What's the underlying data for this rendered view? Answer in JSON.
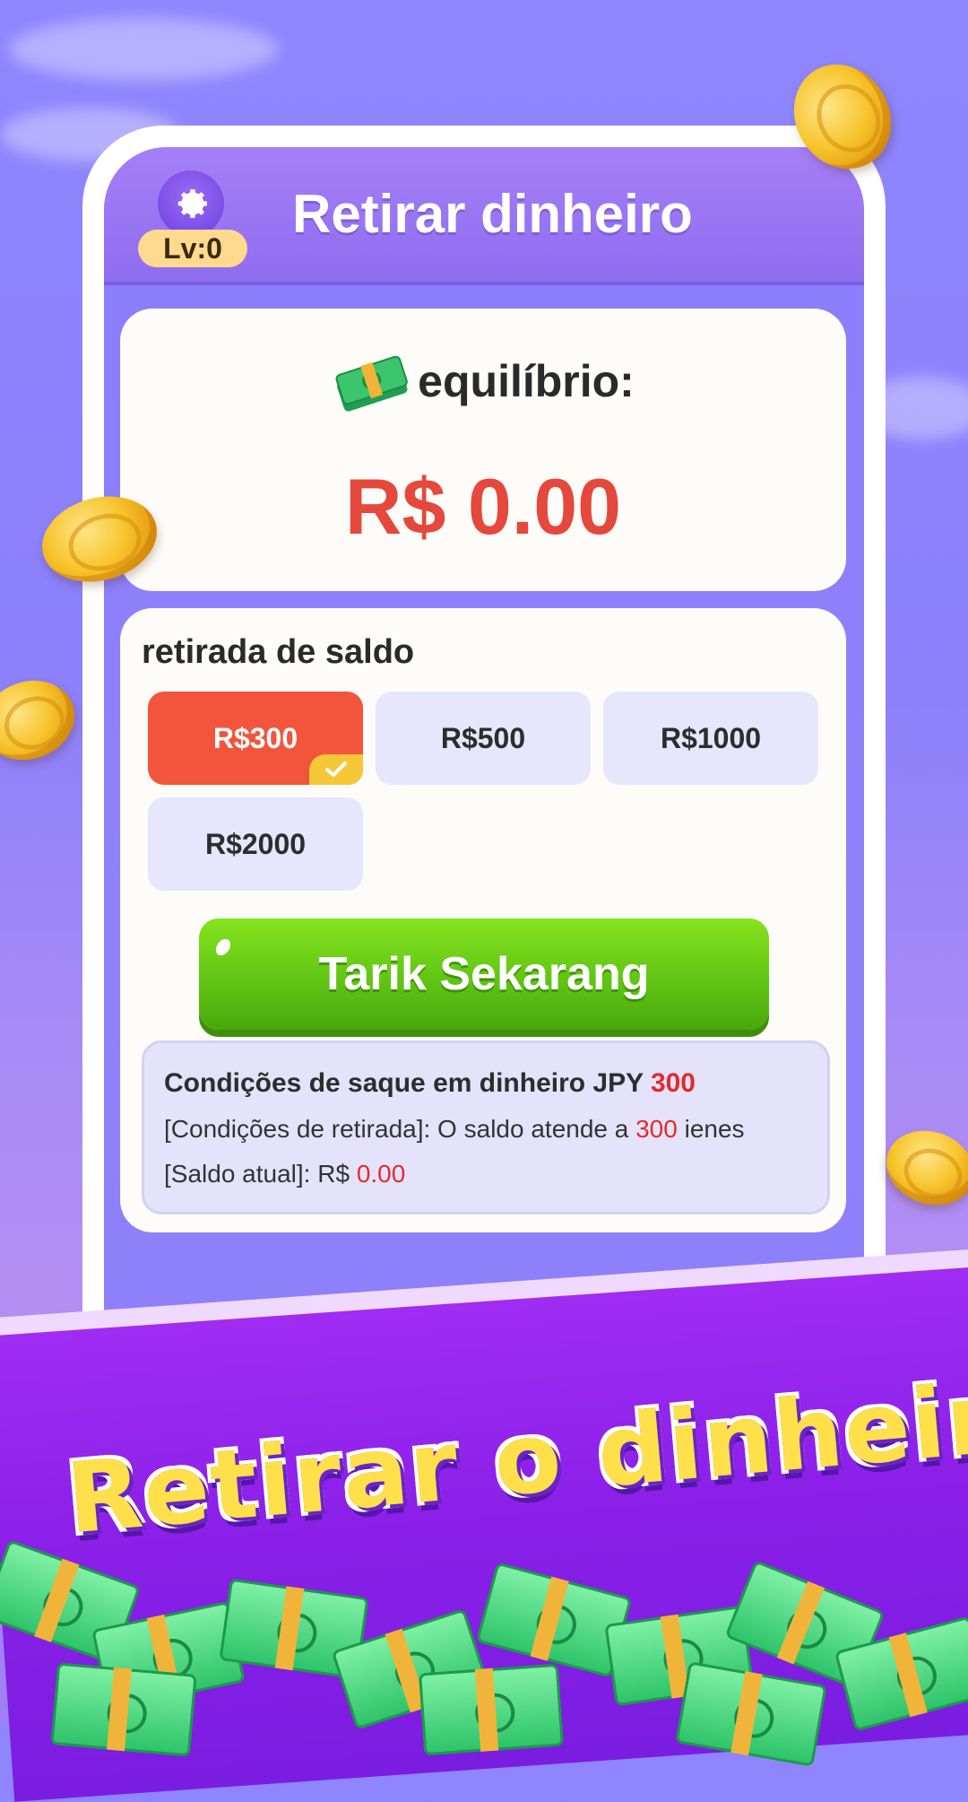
{
  "header": {
    "title": "Retirar dinheiro",
    "level_label": "Lv:0"
  },
  "balance": {
    "label": "equilíbrio:",
    "value": "R$ 0.00"
  },
  "withdraw": {
    "section_title": "retirada de saldo",
    "options": [
      "R$300",
      "R$500",
      "R$1000",
      "R$2000"
    ],
    "selected_index": 0,
    "button_label": "Tarik Sekarang"
  },
  "conditions": {
    "title_prefix": "Condições de saque em dinheiro JPY ",
    "title_amount": "300",
    "line1_prefix": "[Condições de retirada]: O saldo atende a ",
    "line1_amount": "300",
    "line1_suffix": " ienes",
    "line2_prefix": "[Saldo atual]: R$ ",
    "line2_amount": "0.00"
  },
  "banner": {
    "text": "Retirar o dinheiro"
  },
  "colors": {
    "accent_red": "#e5483c",
    "selected_option": "#f3543c",
    "button_green": "#5ec213",
    "banner_yellow": "#ffe04a"
  },
  "icons": [
    "gear-icon",
    "money-stack-icon",
    "checkmark-icon",
    "coin-icon"
  ]
}
